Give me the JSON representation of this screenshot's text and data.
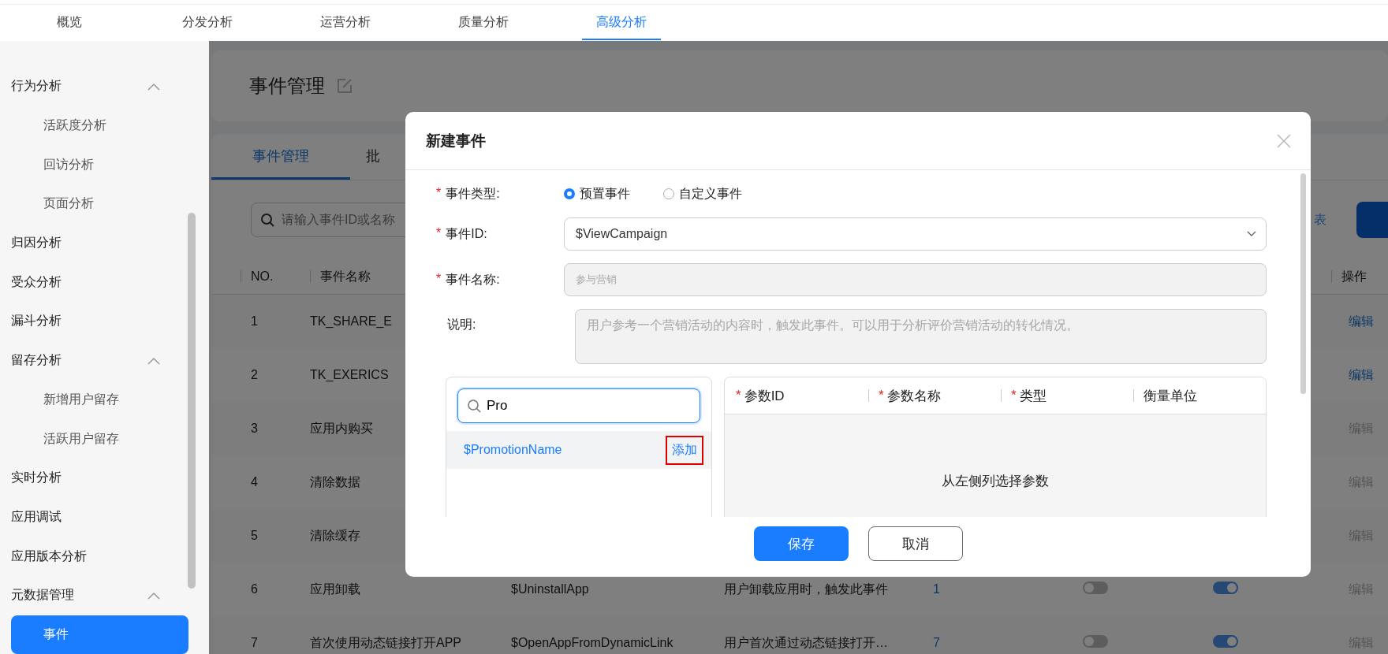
{
  "top_tabs": [
    {
      "label": "概览",
      "selected": false
    },
    {
      "label": "分发分析",
      "selected": false
    },
    {
      "label": "运营分析",
      "selected": false
    },
    {
      "label": "质量分析",
      "selected": false
    },
    {
      "label": "高级分析",
      "selected": true
    }
  ],
  "sidebar": {
    "items": [
      {
        "label": "行为分析",
        "selected": false,
        "expanded": true,
        "children": [
          {
            "label": "活跃度分析",
            "selected": false
          },
          {
            "label": "回访分析",
            "selected": false
          },
          {
            "label": "页面分析",
            "selected": false
          }
        ]
      },
      {
        "label": "归因分析",
        "selected": false
      },
      {
        "label": "受众分析",
        "selected": false
      },
      {
        "label": "漏斗分析",
        "selected": false
      },
      {
        "label": "留存分析",
        "selected": false,
        "expanded": true,
        "children": [
          {
            "label": "新增用户留存",
            "selected": false
          },
          {
            "label": "活跃用户留存",
            "selected": false
          }
        ]
      },
      {
        "label": "实时分析",
        "selected": false
      },
      {
        "label": "应用调试",
        "selected": false
      },
      {
        "label": "应用版本分析",
        "selected": false
      },
      {
        "label": "元数据管理",
        "selected": false,
        "expanded": true,
        "children": [
          {
            "label": "事件",
            "selected": true
          }
        ]
      }
    ]
  },
  "page_title": "事件管理",
  "content_tabs": [
    {
      "label": "事件管理",
      "selected": true
    },
    {
      "label": "批",
      "selected": false
    }
  ],
  "search": {
    "placeholder": "请输入事件ID或名称"
  },
  "toolbar_link": "表",
  "table": {
    "columns": [
      "NO.",
      "事件名称",
      "操作"
    ],
    "rows": [
      {
        "no": "1",
        "name": "TK_SHARE_E",
        "edit": {
          "label": "编辑",
          "disabled": false
        }
      },
      {
        "no": "2",
        "name": "TK_EXERICS",
        "edit": {
          "label": "编辑",
          "disabled": false
        }
      },
      {
        "no": "3",
        "name": "应用内购买",
        "edit": {
          "label": "编辑",
          "disabled": true
        }
      },
      {
        "no": "4",
        "name": "清除数据",
        "edit": {
          "label": "编辑",
          "disabled": true
        }
      },
      {
        "no": "5",
        "name": "清除缓存",
        "edit": {
          "label": "编辑",
          "disabled": true
        }
      },
      {
        "no": "6",
        "name": "应用卸载",
        "event_id": "$UninstallApp",
        "description": "用户卸载应用时，触发此事件",
        "count": "1",
        "toggle_a": {
          "on": false
        },
        "toggle_b": {
          "on": true
        },
        "edit": {
          "label": "编辑",
          "disabled": true
        }
      },
      {
        "no": "7",
        "name": "首次使用动态链接打开APP",
        "event_id": "$OpenAppFromDynamicLink",
        "description": "用户首次通过动态链接打开…",
        "count": "7",
        "toggle_a": {
          "on": false
        },
        "toggle_b": {
          "on": true
        },
        "edit": {
          "label": "编辑",
          "disabled": true
        }
      }
    ]
  },
  "dialog": {
    "title": "新建事件",
    "type_field": {
      "required_mark": "*",
      "label": "事件类型:",
      "options": [
        {
          "label": "预置事件",
          "selected": true
        },
        {
          "label": "自定义事件",
          "selected": false
        }
      ]
    },
    "id_field": {
      "required_mark": "*",
      "label": "事件ID:",
      "value": "$ViewCampaign"
    },
    "name_field": {
      "required_mark": "*",
      "label": "事件名称:",
      "value": "参与营销"
    },
    "description_field": {
      "label": "说明:",
      "value": "用户参考一个营销活动的内容时，触发此事件。可以用于分析评价营销活动的转化情况。"
    },
    "param_search": {
      "value": "Pro"
    },
    "param_results": [
      {
        "name": "$PromotionName",
        "action": "添加",
        "highlighted": true
      }
    ],
    "param_columns": [
      {
        "required_mark": "*",
        "label": "参数ID"
      },
      {
        "required_mark": "*",
        "label": "参数名称"
      },
      {
        "required_mark": "*",
        "label": "类型"
      },
      {
        "label": "衡量单位"
      }
    ],
    "param_empty": "从左侧列选择参数",
    "buttons": [
      {
        "label": "保存",
        "kind": "primary"
      },
      {
        "label": "取消",
        "kind": "default"
      }
    ]
  }
}
